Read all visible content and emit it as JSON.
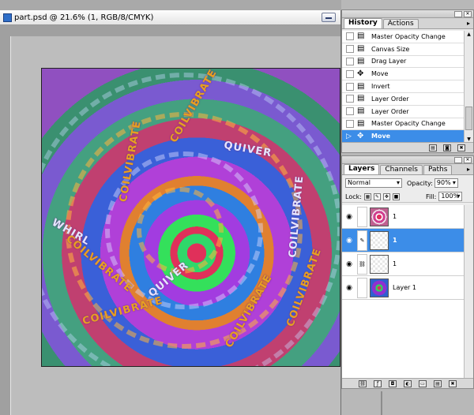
{
  "document": {
    "title": "part.psd @ 21.6% (1, RGB/8/CMYK)",
    "art_words": [
      "COILVIBRATE",
      "QUIVER",
      "WHIRL",
      "COIL",
      "VIBRATE"
    ]
  },
  "history": {
    "tabs": [
      {
        "label": "History",
        "active": true
      },
      {
        "label": "Actions",
        "active": false
      }
    ],
    "items": [
      {
        "label": "Master Opacity Change",
        "icon": "document-icon",
        "selected": false
      },
      {
        "label": "Canvas Size",
        "icon": "document-icon",
        "selected": false
      },
      {
        "label": "Drag Layer",
        "icon": "document-icon",
        "selected": false
      },
      {
        "label": "Move",
        "icon": "move-tool-icon",
        "selected": false
      },
      {
        "label": "Invert",
        "icon": "document-icon",
        "selected": false
      },
      {
        "label": "Layer Order",
        "icon": "document-icon",
        "selected": false
      },
      {
        "label": "Layer Order",
        "icon": "document-icon",
        "selected": false
      },
      {
        "label": "Master Opacity Change",
        "icon": "document-icon",
        "selected": false
      },
      {
        "label": "Move",
        "icon": "move-tool-icon",
        "selected": true
      }
    ]
  },
  "layers": {
    "tabs": [
      {
        "label": "Layers",
        "active": true
      },
      {
        "label": "Channels",
        "active": false
      },
      {
        "label": "Paths",
        "active": false
      }
    ],
    "blend_mode": "Normal",
    "opacity_label": "Opacity:",
    "opacity_value": "90%",
    "lock_label": "Lock:",
    "fill_label": "Fill:",
    "fill_value": "100%",
    "items": [
      {
        "name": "1",
        "thumb": "spiral",
        "selected": false
      },
      {
        "name": "1",
        "thumb": "blank",
        "selected": true
      },
      {
        "name": "1",
        "thumb": "blank",
        "selected": false
      },
      {
        "name": "Layer 1",
        "thumb": "layer1",
        "selected": false
      }
    ]
  },
  "colors": {
    "selection": "#3c8de8",
    "canvas_bg": "#bdbdbd"
  }
}
